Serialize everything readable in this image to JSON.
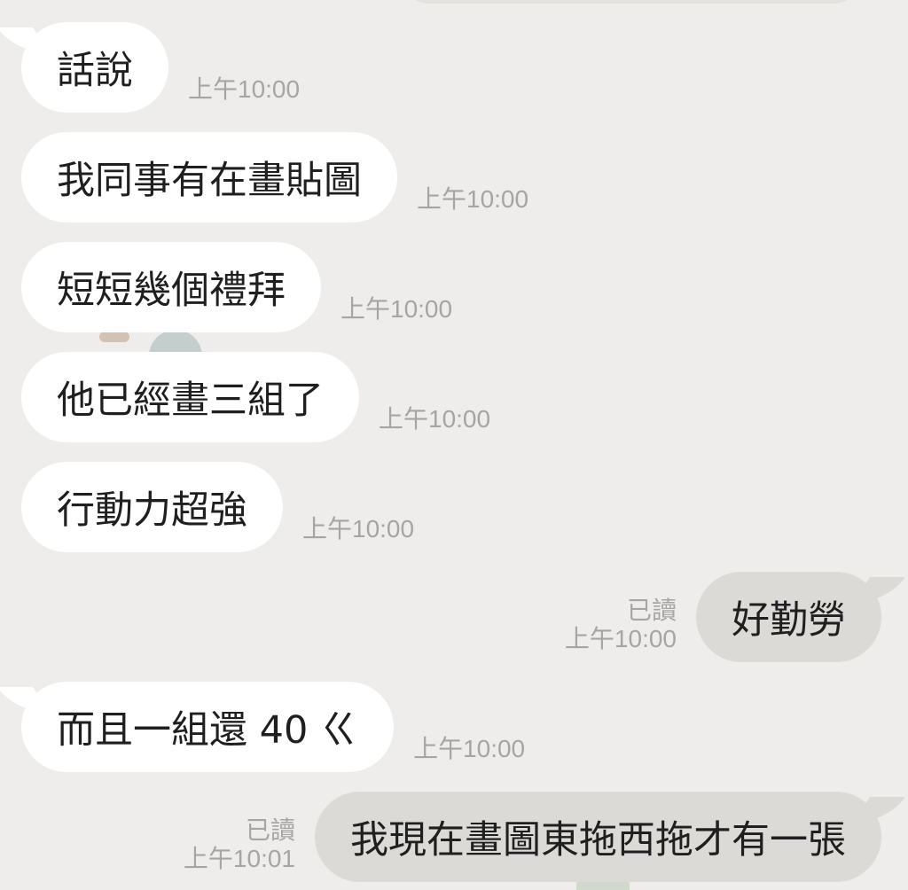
{
  "messages": [
    {
      "dir": "in",
      "text": "話說",
      "time": "上午10:00"
    },
    {
      "dir": "in",
      "text": "我同事有在畫貼圖",
      "time": "上午10:00"
    },
    {
      "dir": "in",
      "text": "短短幾個禮拜",
      "time": "上午10:00"
    },
    {
      "dir": "in",
      "text": "他已經畫三組了",
      "time": "上午10:00"
    },
    {
      "dir": "in",
      "text": "行動力超強",
      "time": "上午10:00"
    },
    {
      "dir": "out",
      "text": "好勤勞",
      "read": "已讀",
      "time": "上午10:00"
    },
    {
      "dir": "in",
      "text": "而且一組還 40 ㄍ",
      "time": "上午10:00"
    },
    {
      "dir": "out",
      "text": "我現在畫圖東拖西拖才有一張",
      "read": "已讀",
      "time": "上午10:01"
    }
  ]
}
